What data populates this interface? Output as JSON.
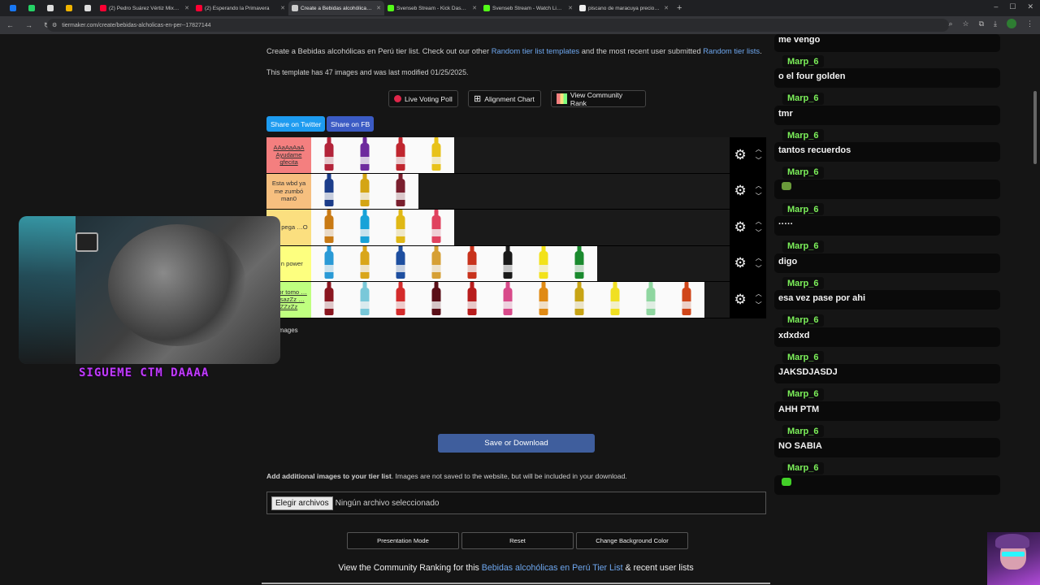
{
  "browser": {
    "tabs": [
      {
        "title": "",
        "icon": "facebook-icon",
        "color": "#1877f2",
        "mini": true
      },
      {
        "title": "",
        "icon": "whatsapp-icon",
        "color": "#25d366",
        "mini": true
      },
      {
        "title": "",
        "icon": "x-icon",
        "color": "#dddddd",
        "mini": true
      },
      {
        "title": "",
        "icon": "mail-icon",
        "color": "#f0b400",
        "mini": true
      },
      {
        "title": "",
        "icon": "diamond-icon",
        "color": "#dddddd",
        "mini": true
      },
      {
        "title": "(2) Pedro Suárez Vértiz Mix aca…",
        "icon": "youtube-icon",
        "color": "#ff0033",
        "mini": false
      },
      {
        "title": "(2) Esperando la Primavera",
        "icon": "youtube-icon",
        "color": "#ff0033",
        "mini": false
      },
      {
        "title": "Create a Bebidas alcohólicas en…",
        "icon": "tiermaker-icon",
        "color": "#cccccc",
        "mini": false,
        "active": true
      },
      {
        "title": "Svenseb Stream - Kick Dashbo…",
        "icon": "kick-icon",
        "color": "#53fc18",
        "mini": false
      },
      {
        "title": "Svenseb Stream - Watch Live o…",
        "icon": "kick-icon",
        "color": "#53fc18",
        "mini": false
      },
      {
        "title": "piscano de maracuya precio - B…",
        "icon": "google-icon",
        "color": "#eeeeee",
        "mini": false
      }
    ],
    "url": "tiermaker.com/create/bebidas-alcholicas-en-per--17827144"
  },
  "page": {
    "intro_pre": "Create a Bebidas alcohólicas en Perú tier list. Check out our other ",
    "intro_link1": "Random tier list templates",
    "intro_mid": " and the most recent user submitted ",
    "intro_link2": "Random tier lists",
    "intro_end": ".",
    "template_info": "This template has 47 images and was last modified 01/25/2025.",
    "buttons": {
      "live_voting": "Live Voting Poll",
      "alignment": "Alignment Chart",
      "community_rank": "View Community Rank",
      "share_twitter": "Share on Twitter",
      "share_fb": "Share on FB"
    },
    "tiers": [
      {
        "label": "AAaAaAaA Ayudame gfecita",
        "color": "#f47f7f",
        "underline": true,
        "items": [
          "#b3243a",
          "#6e2a9e",
          "#c0262f",
          "#e8c21a"
        ]
      },
      {
        "label": "Esta wbd ya me zumbó man0",
        "color": "#f6bf7f",
        "items": [
          "#1c3d8a",
          "#d4a514",
          "#7a1f2e"
        ]
      },
      {
        "label": "…u pega …O",
        "color": "#fbdf7f",
        "items": [
          "#c97a14",
          "#18a2d8",
          "#e0b815",
          "#e0425f"
        ]
      },
      {
        "label": "…n power",
        "color": "#fdff7f",
        "items": [
          "#2a9ad6",
          "#d9a61a",
          "#1e4fa0",
          "#d6a035",
          "#c8321c",
          "#1a1a1a",
          "#f2e21a",
          "#1a8a2e"
        ]
      },
      {
        "label": "…jor tomo …eosazZz …ZZzZz",
        "color": "#bfff7f",
        "underline": true,
        "items": [
          "#8a1620",
          "#79c8d9",
          "#d42b2b",
          "#5a0f18",
          "#b81c1c",
          "#d84a8a",
          "#e08a14",
          "#c8a415",
          "#f0e022",
          "#8fd6a0",
          "#d0461a"
        ]
      }
    ],
    "pool_title": "Un Images",
    "pool": [
      "#7a3a8a",
      "#c8201c",
      "#1a3a1a",
      "#c0262f",
      "#d8d8d8",
      "#3a8a2a",
      "#c88a14",
      "#e8e8e8",
      "#3aa0c8",
      "#5a1a6a",
      "#1a4a1a",
      "#d82020",
      "#e8e8e8",
      "#42b028",
      "#b0b0a0",
      "#e08a14",
      "#e8c21a",
      "#42b028",
      "#1a3a8a"
    ],
    "save_button": "Save or Download",
    "add_images_bold": "Add additional images to your tier list",
    "add_images_rest": ". Images are not saved to the website, but will be included in your download.",
    "file_button": "Elegir archivos",
    "file_none": "Ningún archivo seleccionado",
    "bottom_buttons": {
      "presentation": "Presentation Mode",
      "reset": "Reset",
      "change_bg": "Change Background Color"
    },
    "community_pre": "View the Community Ranking for this ",
    "community_link": "Bebidas alcohólicas en Perú Tier List",
    "community_post": " & recent user lists"
  },
  "overlay": {
    "sigueme": "SIGUEME CTM DAAAA"
  },
  "chat": {
    "top_partial": "me vengo",
    "messages": [
      {
        "user": "Marp_6",
        "text": "o el four golden"
      },
      {
        "user": "Marp_6",
        "text": "tmr"
      },
      {
        "user": "Marp_6",
        "text": "tantos recuerdos"
      },
      {
        "user": "Marp_6",
        "text": "",
        "emote": "#6a9a3a"
      },
      {
        "user": "Marp_6",
        "text": "·····"
      },
      {
        "user": "Marp_6",
        "text": "digo"
      },
      {
        "user": "Marp_6",
        "text": "esa vez pase por ahi"
      },
      {
        "user": "Marp_6",
        "text": "xdxdxd"
      },
      {
        "user": "Marp_6",
        "text": "JAKSDJASDJ"
      },
      {
        "user": "Marp_6",
        "text": "AHH PTM"
      },
      {
        "user": "Marp_6",
        "text": "NO SABIA"
      },
      {
        "user": "Marp_6",
        "text": "",
        "emote": "#42d028"
      }
    ]
  }
}
